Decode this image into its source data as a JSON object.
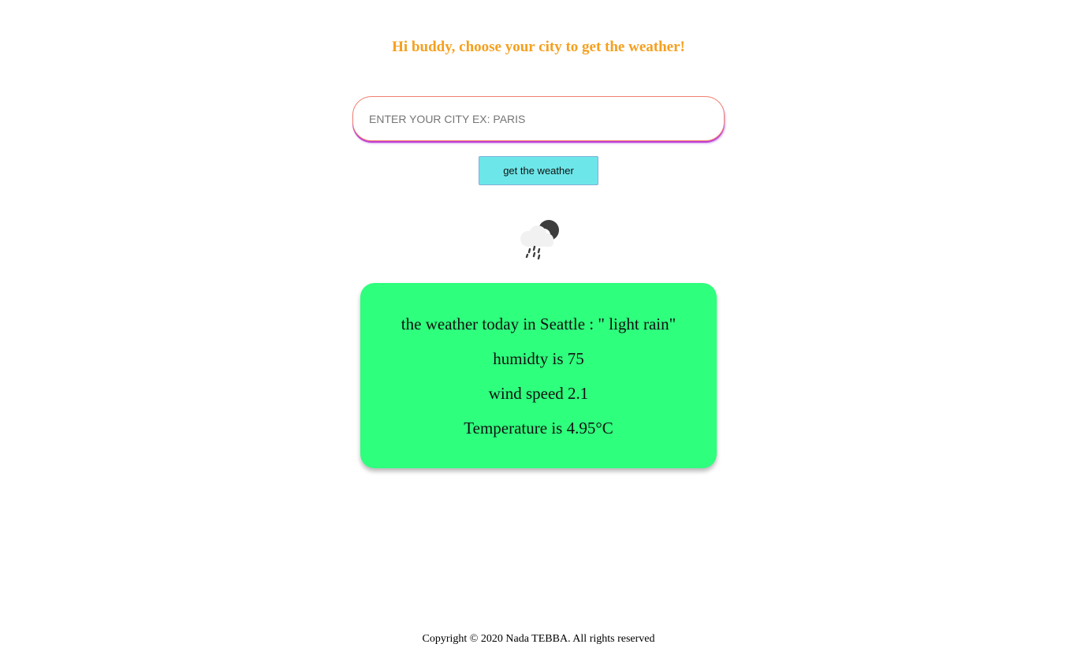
{
  "header": {
    "title": "Hi buddy, choose your city to get the weather!"
  },
  "search": {
    "placeholder": "ENTER YOUR CITY EX: PARIS",
    "value": "",
    "button_label": "get the weather"
  },
  "weather": {
    "icon": "night-cloud-rain-icon",
    "description_line": "the weather today in Seattle : \" light rain\"",
    "humidity_line": "humidty is 75",
    "wind_line": "wind speed 2.1",
    "temperature_line": "Temperature is 4.95°C"
  },
  "footer": {
    "copyright": "Copyright © 2020 Nada TEBBA. All rights reserved"
  },
  "colors": {
    "heading": "#f5a01e",
    "button": "#6de6e9",
    "card": "#2eff7d"
  }
}
